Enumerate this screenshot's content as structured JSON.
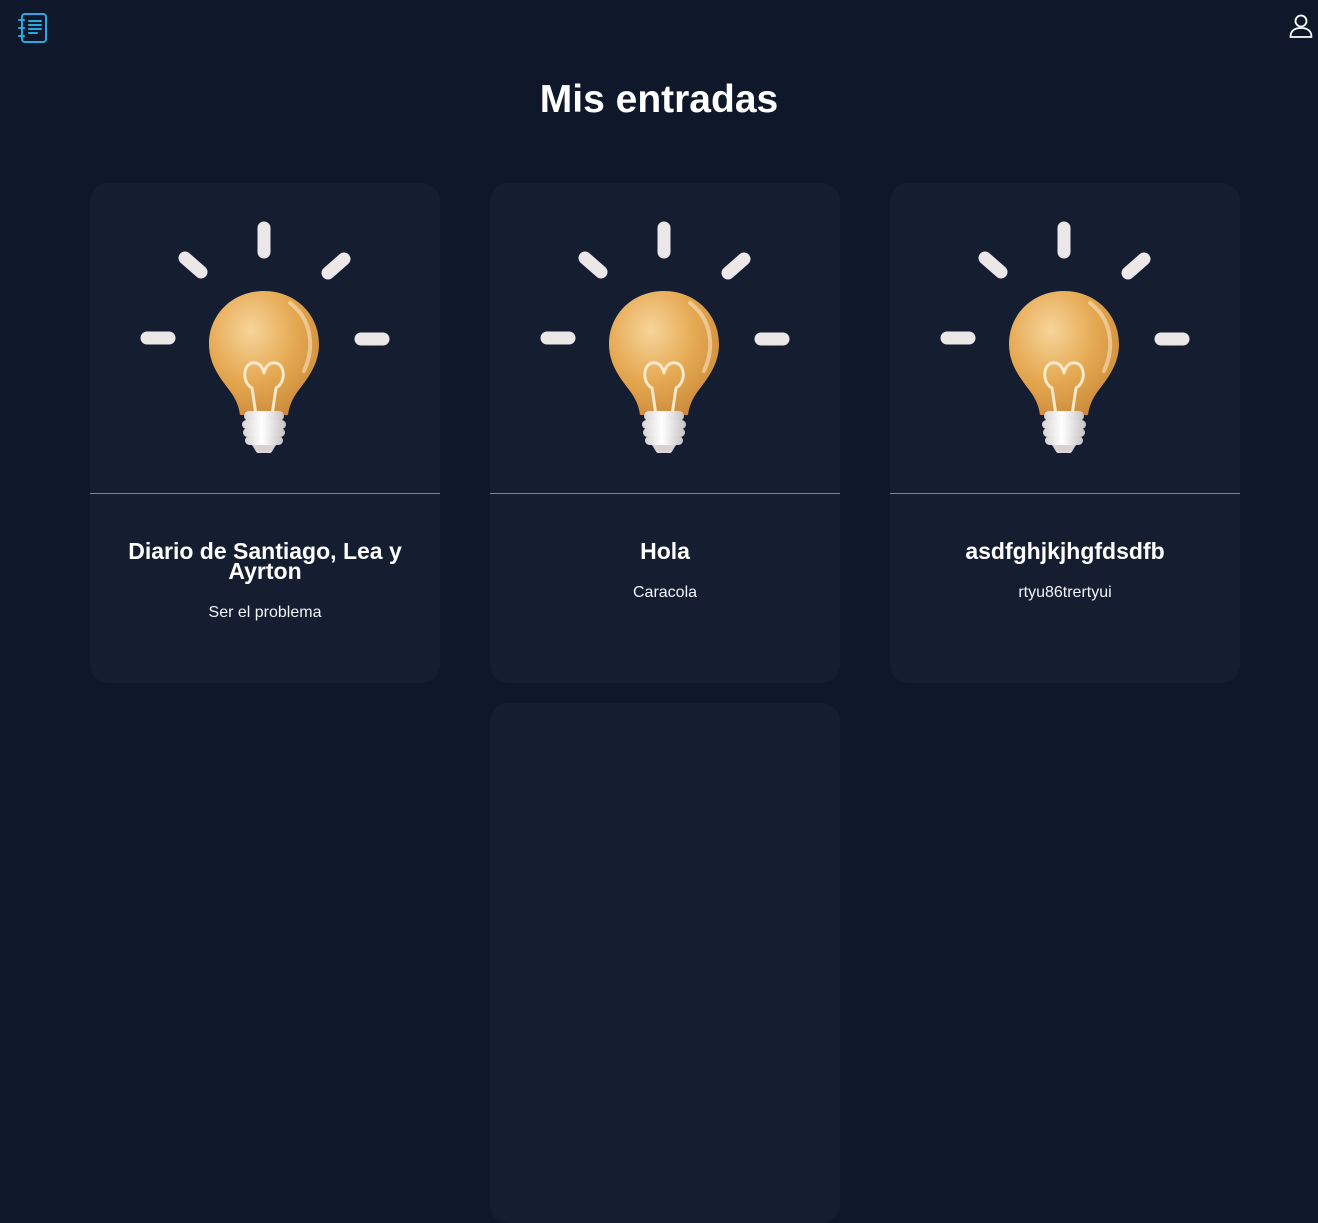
{
  "header": {
    "logo_icon": "notebook-list-icon",
    "profile_icon": "user-profile-icon",
    "accent_color": "#27a9e1"
  },
  "page": {
    "title": "Mis entradas"
  },
  "entries": [
    {
      "title": "Diario de Santiago, Lea y Ayrton",
      "subtitle": "Ser el problema",
      "image_icon": "lightbulb-icon"
    },
    {
      "title": "Hola",
      "subtitle": "Caracola",
      "image_icon": "lightbulb-icon"
    },
    {
      "title": "asdfghjkjhgfdsdfb",
      "subtitle": "rtyu86trertyui",
      "image_icon": "lightbulb-icon"
    }
  ],
  "add_card": {
    "icon": "plus-icon"
  }
}
